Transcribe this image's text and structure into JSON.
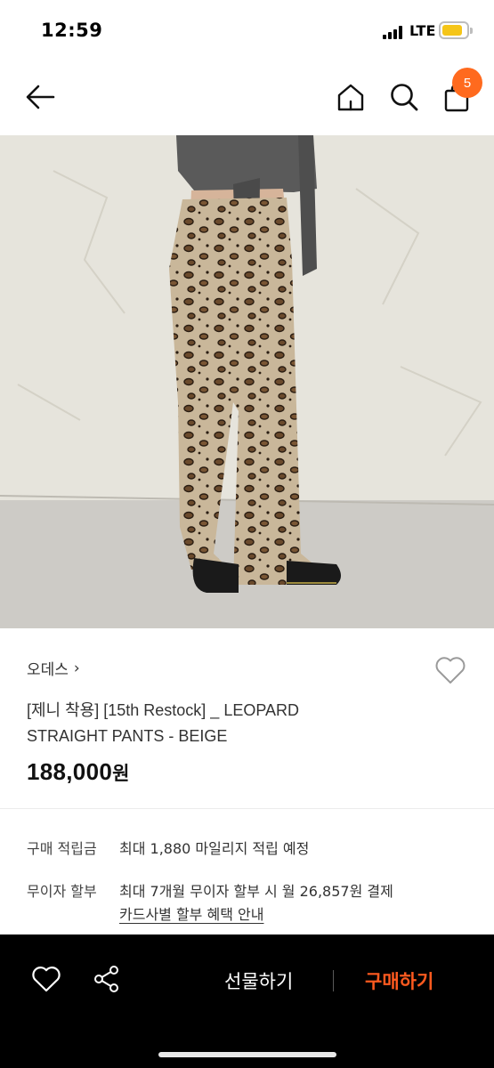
{
  "status_bar": {
    "time": "12:59",
    "network": "LTE",
    "battery_color": "#f5c518"
  },
  "nav": {
    "back_icon": "arrow-left-icon",
    "home_icon": "home-icon",
    "search_icon": "search-icon",
    "cart_icon": "shopping-bag-icon",
    "cart_count": "5",
    "badge_color": "#ff6a1e"
  },
  "product": {
    "image_icon": "product-photo",
    "brand": "오데스",
    "brand_chevron": "›",
    "title": "[제니 착용] [15th Restock] _ LEOPARD STRAIGHT PANTS - BEIGE",
    "price_number": "188,000",
    "price_unit": "원"
  },
  "info": {
    "points_label": "구매 적립금",
    "points_value": "최대 1,880 마일리지 적립 예정",
    "installment_label": "무이자 할부",
    "installment_value": "최대 7개월 무이자 할부 시 월 26,857원 결제",
    "card_benefit_link": "카드사별 할부 혜택 안내"
  },
  "bottom_bar": {
    "wishlist_icon": "heart-icon",
    "share_icon": "share-icon",
    "gift_label": "선물하기",
    "buy_label": "구매하기",
    "buy_color": "#ff5a1f"
  }
}
